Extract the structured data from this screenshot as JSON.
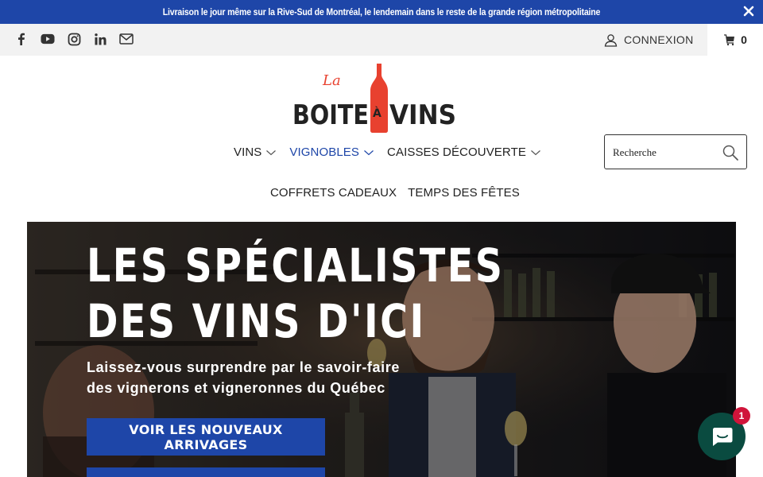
{
  "announcement": {
    "text": "Livraison le jour même sur la Rive-Sud de Montréal, le lendemain dans le reste de la grande région métropolitaine",
    "close_icon": "close-icon"
  },
  "utility": {
    "social_icons": [
      "facebook-icon",
      "youtube-icon",
      "instagram-icon",
      "linkedin-icon",
      "email-icon"
    ],
    "login_label": "CONNEXION",
    "cart_count": "0"
  },
  "logo": {
    "top_word": "La",
    "left_word": "BOITE",
    "accent": "À",
    "right_word": "VINS"
  },
  "nav": {
    "row1": [
      {
        "label": "VINS",
        "has_dropdown": true,
        "active": false
      },
      {
        "label": "VIGNOBLES",
        "has_dropdown": true,
        "active": true
      },
      {
        "label": "CAISSES DÉCOUVERTE",
        "has_dropdown": true,
        "active": false
      }
    ],
    "row2": [
      {
        "label": "COFFRETS CADEAUX"
      },
      {
        "label": "TEMPS DES FÊTES"
      }
    ]
  },
  "search": {
    "placeholder": "Recherche"
  },
  "hero": {
    "title_line1": "LES SPÉCIALISTES",
    "title_line2": "DES VINS D'ICI",
    "subtitle_line1": "Laissez-vous surprendre par le savoir-faire",
    "subtitle_line2": "des vignerons et vigneronnes du Québec",
    "button_label": "VOIR LES NOUVEAUX ARRIVAGES"
  },
  "chat": {
    "badge": "1"
  },
  "colors": {
    "brand_blue": "#1e46a8",
    "logo_red": "#e8412f",
    "chat_green": "#0a4b40",
    "badge_red": "#d0143a"
  }
}
